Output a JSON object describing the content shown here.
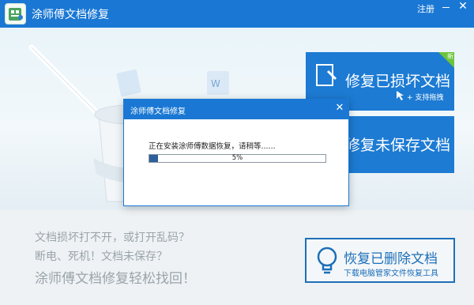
{
  "window": {
    "title": "涂师傅文档修复",
    "register_label": "注册"
  },
  "tiles": {
    "repair_damaged": {
      "label": "修复已损坏文档",
      "sub": "支持拖拽"
    },
    "repair_unsaved": {
      "label": "修复未保存文档"
    }
  },
  "slogans": [
    "文档损坏打不开，或打开乱码？",
    "断电、死机！文档未保存？",
    "涂师傅文档修复轻松找回！"
  ],
  "recover_button": {
    "label": "恢复已删除文档",
    "sub": "下载电脑管家文件恢复工具"
  },
  "dialog": {
    "title": "涂师傅文档修复",
    "message": "正在安装涂师傅数据恢复，请稍等......",
    "progress_text": "5%",
    "progress_fraction": 0.05
  },
  "colors": {
    "accent": "#1a78d4",
    "progress": "#2d5f9b"
  }
}
